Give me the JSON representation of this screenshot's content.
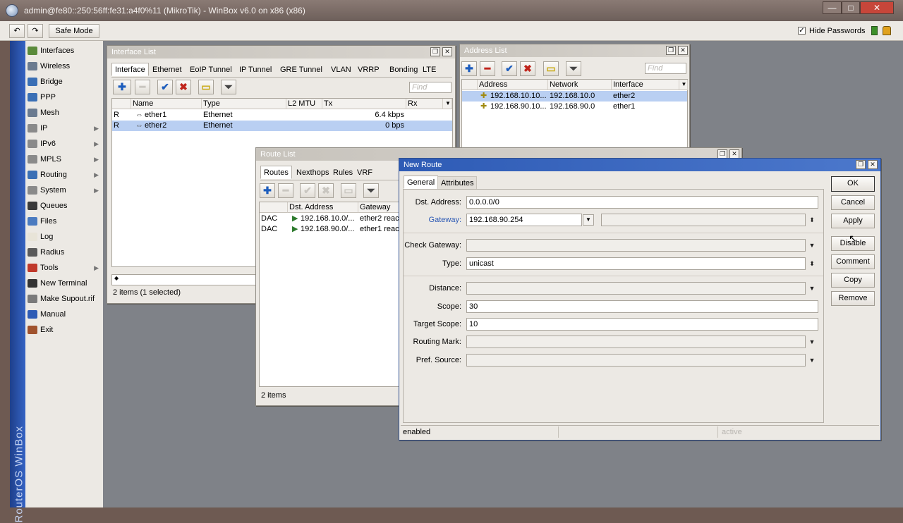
{
  "window": {
    "title": "admin@fe80::250:56ff:fe31:a4f0%11 (MikroTik) - WinBox v6.0 on x86 (x86)",
    "minimize": "—",
    "maximize": "□",
    "close": "✕"
  },
  "toolbar": {
    "undo": "↶",
    "redo": "↷",
    "safe_mode": "Safe Mode",
    "hide_passwords_checked": "✓",
    "hide_passwords": "Hide Passwords"
  },
  "sidebar": {
    "brand": "RouterOS WinBox",
    "items": [
      {
        "label": "Interfaces",
        "icon": "interfaces-icon",
        "color": "#5a8a3a",
        "submenu": ""
      },
      {
        "label": "Wireless",
        "icon": "wireless-icon",
        "color": "#6b7b90",
        "submenu": ""
      },
      {
        "label": "Bridge",
        "icon": "bridge-icon",
        "color": "#3a6fb5",
        "submenu": ""
      },
      {
        "label": "PPP",
        "icon": "ppp-icon",
        "color": "#3a6fb5",
        "submenu": ""
      },
      {
        "label": "Mesh",
        "icon": "mesh-icon",
        "color": "#6b7b90",
        "submenu": ""
      },
      {
        "label": "IP",
        "icon": "ip-icon",
        "color": "#8a8a8a",
        "submenu": "▶"
      },
      {
        "label": "IPv6",
        "icon": "ipv6-icon",
        "color": "#8a8a8a",
        "submenu": "▶"
      },
      {
        "label": "MPLS",
        "icon": "mpls-icon",
        "color": "#8a8a8a",
        "submenu": "▶"
      },
      {
        "label": "Routing",
        "icon": "routing-icon",
        "color": "#3a6fb5",
        "submenu": "▶"
      },
      {
        "label": "System",
        "icon": "system-icon",
        "color": "#8a8a8a",
        "submenu": "▶"
      },
      {
        "label": "Queues",
        "icon": "queues-icon",
        "color": "#3a3a3a",
        "submenu": ""
      },
      {
        "label": "Files",
        "icon": "files-icon",
        "color": "#4b7bc0",
        "submenu": ""
      },
      {
        "label": "Log",
        "icon": "log-icon",
        "color": "#e8e4d8",
        "submenu": ""
      },
      {
        "label": "Radius",
        "icon": "radius-icon",
        "color": "#5a5a5a",
        "submenu": ""
      },
      {
        "label": "Tools",
        "icon": "tools-icon",
        "color": "#c0392b",
        "submenu": "▶"
      },
      {
        "label": "New Terminal",
        "icon": "terminal-icon",
        "color": "#333333",
        "submenu": ""
      },
      {
        "label": "Make Supout.rif",
        "icon": "supout-icon",
        "color": "#7a7a7a",
        "submenu": ""
      },
      {
        "label": "Manual",
        "icon": "manual-icon",
        "color": "#2e5bb5",
        "submenu": ""
      },
      {
        "label": "Exit",
        "icon": "exit-icon",
        "color": "#a0522d",
        "submenu": ""
      }
    ]
  },
  "interface_list": {
    "title": "Interface List",
    "tabs": [
      "Interface",
      "Ethernet",
      "EoIP Tunnel",
      "IP Tunnel",
      "GRE Tunnel",
      "VLAN",
      "VRRP",
      "Bonding",
      "LTE"
    ],
    "find_placeholder": "Find",
    "columns": [
      "",
      "Name",
      "Type",
      "L2 MTU",
      "Tx",
      "Rx"
    ],
    "rows": [
      {
        "flag": "R",
        "name": "ether1",
        "type": "Ethernet",
        "l2mtu": "",
        "tx": "6.4 kbps",
        "rx": ""
      },
      {
        "flag": "R",
        "name": "ether2",
        "type": "Ethernet",
        "l2mtu": "",
        "tx": "0 bps",
        "rx": ""
      }
    ],
    "status": "2 items (1 selected)",
    "add_row": "◆"
  },
  "address_list": {
    "title": "Address List",
    "find_placeholder": "Find",
    "columns": [
      "Address",
      "Network",
      "Interface"
    ],
    "rows": [
      {
        "address": "192.168.10.10...",
        "network": "192.168.10.0",
        "interface": "ether2"
      },
      {
        "address": "192.168.90.10...",
        "network": "192.168.90.0",
        "interface": "ether1"
      }
    ]
  },
  "route_list": {
    "title": "Route List",
    "tabs": [
      "Routes",
      "Nexthops",
      "Rules",
      "VRF"
    ],
    "columns": [
      "",
      "Dst. Address",
      "Gateway"
    ],
    "rows": [
      {
        "flag": "DAC",
        "dst": "192.168.10.0/...",
        "gateway": "ether2 reac"
      },
      {
        "flag": "DAC",
        "dst": "192.168.90.0/...",
        "gateway": "ether1 reac"
      }
    ],
    "status": "2 items"
  },
  "new_route": {
    "title": "New Route",
    "tabs": [
      "General",
      "Attributes"
    ],
    "fields": {
      "dst_address": {
        "label": "Dst. Address:",
        "value": "0.0.0.0/0"
      },
      "gateway": {
        "label": "Gateway:",
        "value": "192.168.90.254"
      },
      "check_gateway": {
        "label": "Check Gateway:",
        "value": ""
      },
      "type": {
        "label": "Type:",
        "value": "unicast"
      },
      "distance": {
        "label": "Distance:",
        "value": ""
      },
      "scope": {
        "label": "Scope:",
        "value": "30"
      },
      "target_scope": {
        "label": "Target Scope:",
        "value": "10"
      },
      "routing_mark": {
        "label": "Routing Mark:",
        "value": ""
      },
      "pref_source": {
        "label": "Pref. Source:",
        "value": ""
      }
    },
    "buttons": [
      "OK",
      "Cancel",
      "Apply",
      "Disable",
      "Comment",
      "Copy",
      "Remove"
    ],
    "status_left": "enabled",
    "status_mid": "",
    "status_right": "active",
    "gateway_color": "#2e5bb5"
  },
  "icons": {
    "add": "✚",
    "remove": "━",
    "enable": "✔",
    "disable": "✖",
    "comment": "▭",
    "filter": "⏷",
    "dropdown": "▼",
    "updown": "⬍",
    "window_restore": "❐",
    "window_close": "✕"
  }
}
